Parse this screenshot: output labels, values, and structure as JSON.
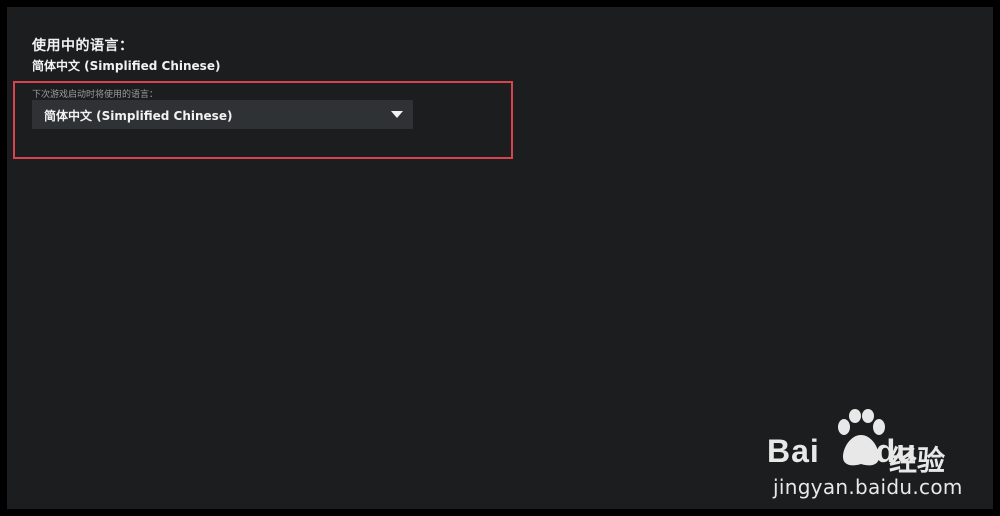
{
  "settings": {
    "current_language_heading": "使用中的语言：",
    "current_language_value": "简体中文 (Simplified Chinese)",
    "next_launch_label": "下次游戏启动时将使用的语言：",
    "language_dropdown": {
      "selected": "简体中文 (Simplified Chinese)"
    }
  },
  "watermark": {
    "brand": "Baidu",
    "product": "经验",
    "url": "jingyan.baidu.com"
  },
  "colors": {
    "panel_background": "#1b1d1e",
    "highlight_border": "#d9434e",
    "dropdown_background": "#2f3234"
  },
  "icons": {
    "dropdown_arrow": "caret-down-icon",
    "watermark_logo": "baidu-paw-logo"
  }
}
